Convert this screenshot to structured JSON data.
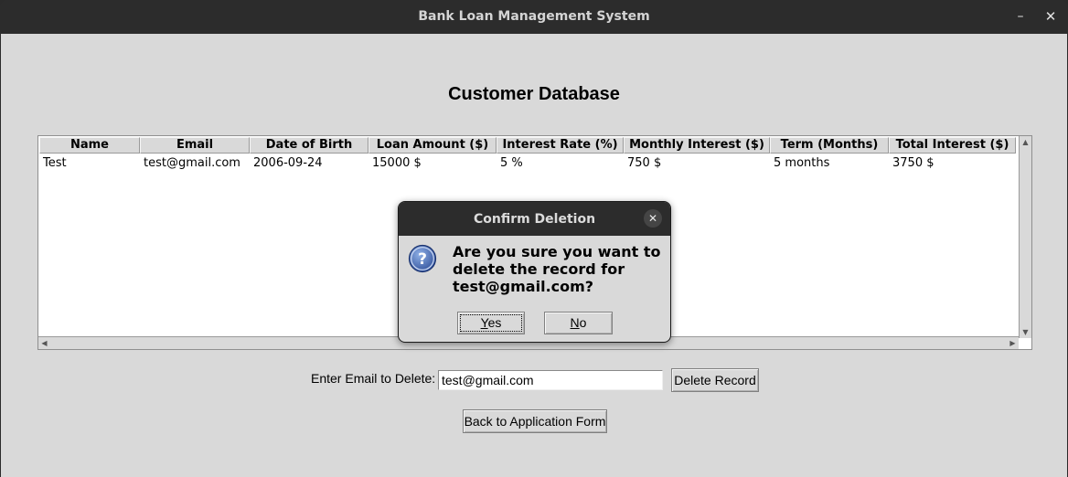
{
  "window": {
    "title": "Bank Loan Management System",
    "minimize_glyph": "–",
    "close_glyph": "✕"
  },
  "page": {
    "heading": "Customer Database"
  },
  "table": {
    "columns": [
      "Name",
      "Email",
      "Date of Birth",
      "Loan Amount ($)",
      "Interest Rate (%)",
      "Monthly Interest ($)",
      "Term (Months)",
      "Total Interest ($)"
    ],
    "rows": [
      [
        "Test",
        "test@gmail.com",
        "2006-09-24",
        "15000 $",
        "5 %",
        "750 $",
        "5 months",
        "3750 $"
      ]
    ]
  },
  "delete_form": {
    "label": "Enter Email to Delete:",
    "email_value": "test@gmail.com",
    "delete_button": "Delete Record",
    "back_button": "Back to Application Form"
  },
  "dialog": {
    "title": "Confirm Deletion",
    "close_glyph": "✕",
    "icon": "question-icon",
    "message_line1": "Are you sure you want to",
    "message_line2": "delete the record for",
    "message_line3": "test@gmail.com?",
    "yes_mnemonic": "Y",
    "yes_rest": "es",
    "no_mnemonic": "N",
    "no_rest": "o"
  },
  "colors": {
    "titlebar": "#2c2c2c",
    "window_bg": "#d9d9d9",
    "table_bg": "#ffffff",
    "icon_blue": "#3b5fa8"
  }
}
